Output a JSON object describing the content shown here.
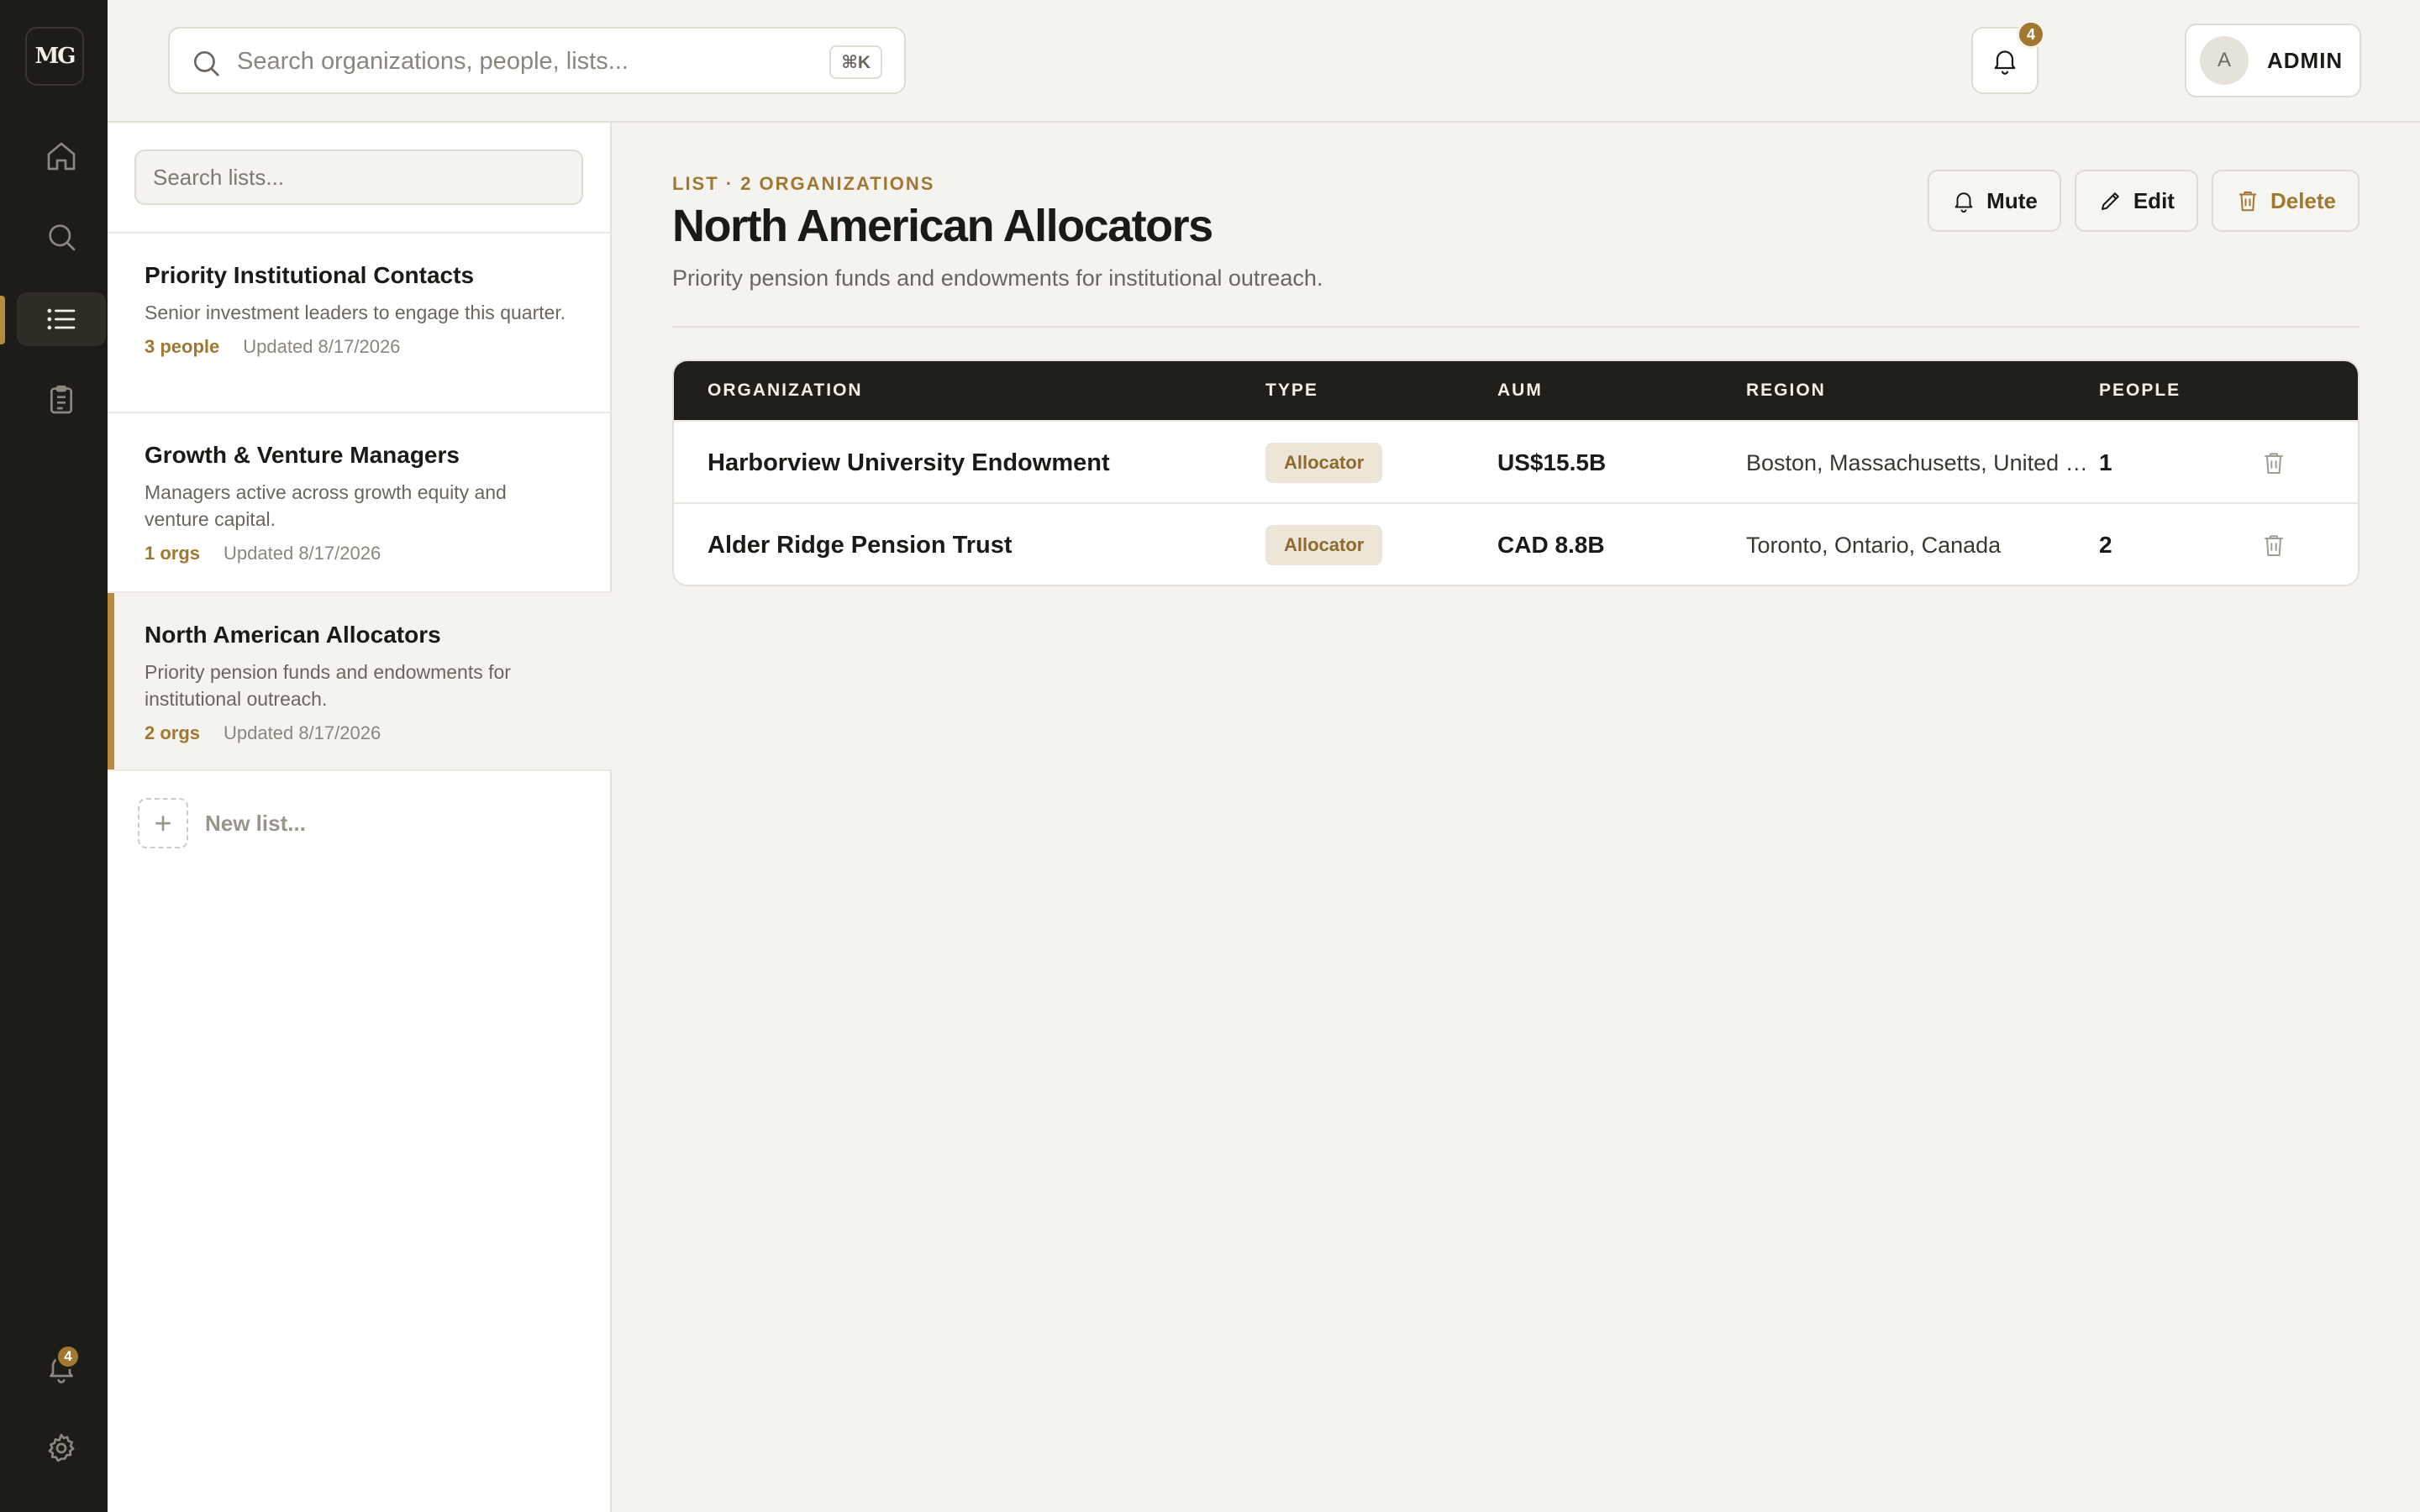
{
  "rail": {
    "logo": "MG",
    "notification_count": "4"
  },
  "topbar": {
    "search_placeholder": "Search organizations, people, lists...",
    "shortcut": "⌘K",
    "notification_count": "4",
    "user_initial": "A",
    "user_label": "ADMIN"
  },
  "lists": {
    "search_placeholder": "Search lists...",
    "items": [
      {
        "title": "Priority Institutional Contacts",
        "description": "Senior investment leaders to engage this quarter.",
        "count": "3 people",
        "updated": "Updated 8/17/2026"
      },
      {
        "title": "Growth & Venture Managers",
        "description": "Managers active across growth equity and venture capital.",
        "count": "1 orgs",
        "updated": "Updated 8/17/2026"
      },
      {
        "title": "North American Allocators",
        "description": "Priority pension funds and endowments for institutional outreach.",
        "count": "2 orgs",
        "updated": "Updated 8/17/2026"
      }
    ],
    "new_list_label": "New list..."
  },
  "main": {
    "eyebrow": "LIST · 2 ORGANIZATIONS",
    "title": "North American Allocators",
    "description": "Priority pension funds and endowments for institutional outreach.",
    "actions": {
      "mute": "Mute",
      "edit": "Edit",
      "delete": "Delete"
    },
    "table": {
      "headers": [
        "ORGANIZATION",
        "TYPE",
        "AUM",
        "REGION",
        "PEOPLE"
      ],
      "rows": [
        {
          "organization": "Harborview University Endowment",
          "type": "Allocator",
          "aum": "US$15.5B",
          "region": "Boston, Massachusetts, United States",
          "people": "1"
        },
        {
          "organization": "Alder Ridge Pension Trust",
          "type": "Allocator",
          "aum": "CAD 8.8B",
          "region": "Toronto, Ontario, Canada",
          "people": "2"
        }
      ]
    }
  },
  "colors": {
    "accent": "#a07830",
    "rail_bg": "#1e1c18",
    "page_bg": "#f4f3ef"
  }
}
